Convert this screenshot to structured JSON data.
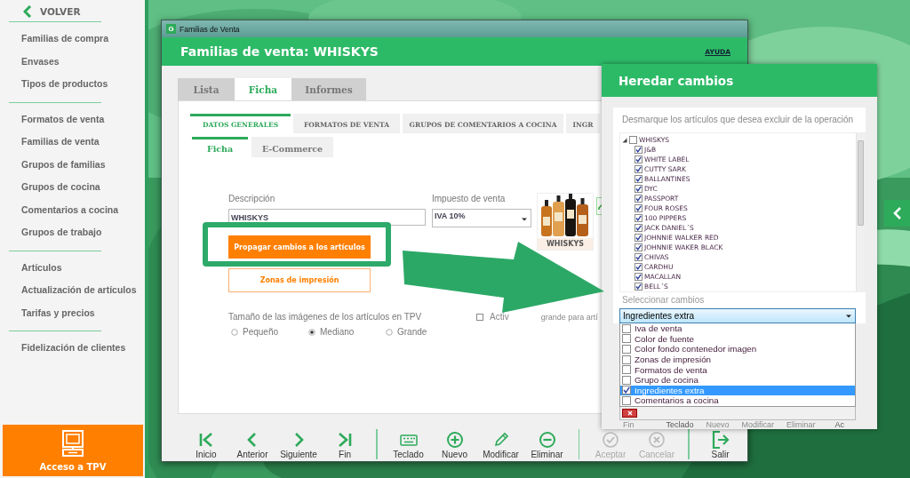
{
  "sidebar": {
    "back": "VOLVER",
    "groups": [
      [
        "Familias de compra",
        "Envases",
        "Tipos de productos"
      ],
      [
        "Formatos de venta",
        "Familias de venta",
        "Grupos de familias",
        "Grupos de cocina",
        "Comentarios a cocina",
        "Grupos de trabajo"
      ],
      [
        "Artículos",
        "Actualización de artículos",
        "Tarifas y precios"
      ],
      [
        "Fidelización de clientes"
      ]
    ],
    "tpv_button": "Acceso a TPV"
  },
  "window": {
    "app_icon": "G",
    "title": "Familias de Venta",
    "heading": "Familias de venta: WHISKYS",
    "help": "AYUDA",
    "tabs": [
      {
        "label": "Lista",
        "selected": false
      },
      {
        "label": "Ficha",
        "selected": true
      },
      {
        "label": "Informes",
        "selected": false
      }
    ],
    "section_tabs": [
      {
        "label": "DATOS GENERALES",
        "selected": true
      },
      {
        "label": "FORMATOS DE VENTA",
        "selected": false
      },
      {
        "label": "GRUPOS DE COMENTARIOS A COCINA",
        "selected": false
      },
      {
        "label": "INGR",
        "selected": false
      }
    ],
    "sub_tabs": [
      {
        "label": "Ficha",
        "selected": true
      },
      {
        "label": "E-Commerce",
        "selected": false
      }
    ],
    "form": {
      "description_label": "Descripción",
      "description_value": "WHISKYS",
      "tax_label": "Impuesto de venta",
      "tax_value": "IVA 10%",
      "image_caption": "WHISKYS",
      "propagate_button": "Propagar cambios a los artículos",
      "zones_button": "Zonas de impresión",
      "size_label": "Tamaño de las imágenes de los artículos en TPV",
      "sizes": [
        {
          "label": "Pequeño",
          "selected": false
        },
        {
          "label": "Mediano",
          "selected": true
        },
        {
          "label": "Grande",
          "selected": false
        }
      ],
      "large_image_checkbox": {
        "label_parts": [
          "Activ",
          "grande para artí"
        ],
        "checked": false
      }
    },
    "toolbar": [
      [
        {
          "label": "Inicio",
          "disabled": false
        },
        {
          "label": "Anterior",
          "disabled": false
        },
        {
          "label": "Siguiente",
          "disabled": false
        },
        {
          "label": "Fin",
          "disabled": false
        }
      ],
      [
        {
          "label": "Teclado",
          "disabled": false
        },
        {
          "label": "Nuevo",
          "disabled": false
        },
        {
          "label": "Modificar",
          "disabled": false
        },
        {
          "label": "Eliminar",
          "disabled": false
        }
      ],
      [
        {
          "label": "Aceptar",
          "disabled": true
        },
        {
          "label": "Cancelar",
          "disabled": true
        }
      ],
      [
        {
          "label": "Salir",
          "disabled": false
        }
      ]
    ]
  },
  "dialog": {
    "title": "Heredar cambios",
    "instructions": "Desmarque los artículos que desea excluir de la operación",
    "tree": {
      "label": "WHISKYS",
      "checked": false,
      "expanded": true,
      "children": [
        {
          "label": "J&B",
          "checked": true
        },
        {
          "label": "WHITE LABEL",
          "checked": true
        },
        {
          "label": "CUTTY SARK",
          "checked": true
        },
        {
          "label": "BALLANTINES",
          "checked": true
        },
        {
          "label": "DYC",
          "checked": true
        },
        {
          "label": "PASSPORT",
          "checked": true
        },
        {
          "label": "FOUR ROSES",
          "checked": true
        },
        {
          "label": "100 PIPPERS",
          "checked": true
        },
        {
          "label": "JACK DANIEL´S",
          "checked": true
        },
        {
          "label": "JOHNNIE WALKER RED",
          "checked": true
        },
        {
          "label": "JOHNNIE WAKER BLACK",
          "checked": true
        },
        {
          "label": "CHIVAS",
          "checked": true
        },
        {
          "label": "CARDHU",
          "checked": true
        },
        {
          "label": "MACALLAN",
          "checked": true
        },
        {
          "label": "BELL´S",
          "checked": true
        }
      ]
    },
    "changes_label": "Seleccionar cambios",
    "changes_value": "Ingredientes extra",
    "changes_options": [
      {
        "label": "Iva de venta",
        "checked": false,
        "selected": false
      },
      {
        "label": "Color de fuente",
        "checked": false,
        "selected": false
      },
      {
        "label": "Color fondo contenedor imagen",
        "checked": false,
        "selected": false
      },
      {
        "label": "Zonas de impresión",
        "checked": false,
        "selected": false
      },
      {
        "label": "Formatos de venta",
        "checked": false,
        "selected": false
      },
      {
        "label": "Grupo de cocina",
        "checked": false,
        "selected": false
      },
      {
        "label": "Ingredientes extra",
        "checked": true,
        "selected": true
      },
      {
        "label": "Comentarios a cocina",
        "checked": false,
        "selected": false
      }
    ]
  },
  "behind_toolbar": [
    "Fin",
    "Teclado",
    "Nuevo",
    "Modificar",
    "Eliminar",
    "Ac"
  ]
}
